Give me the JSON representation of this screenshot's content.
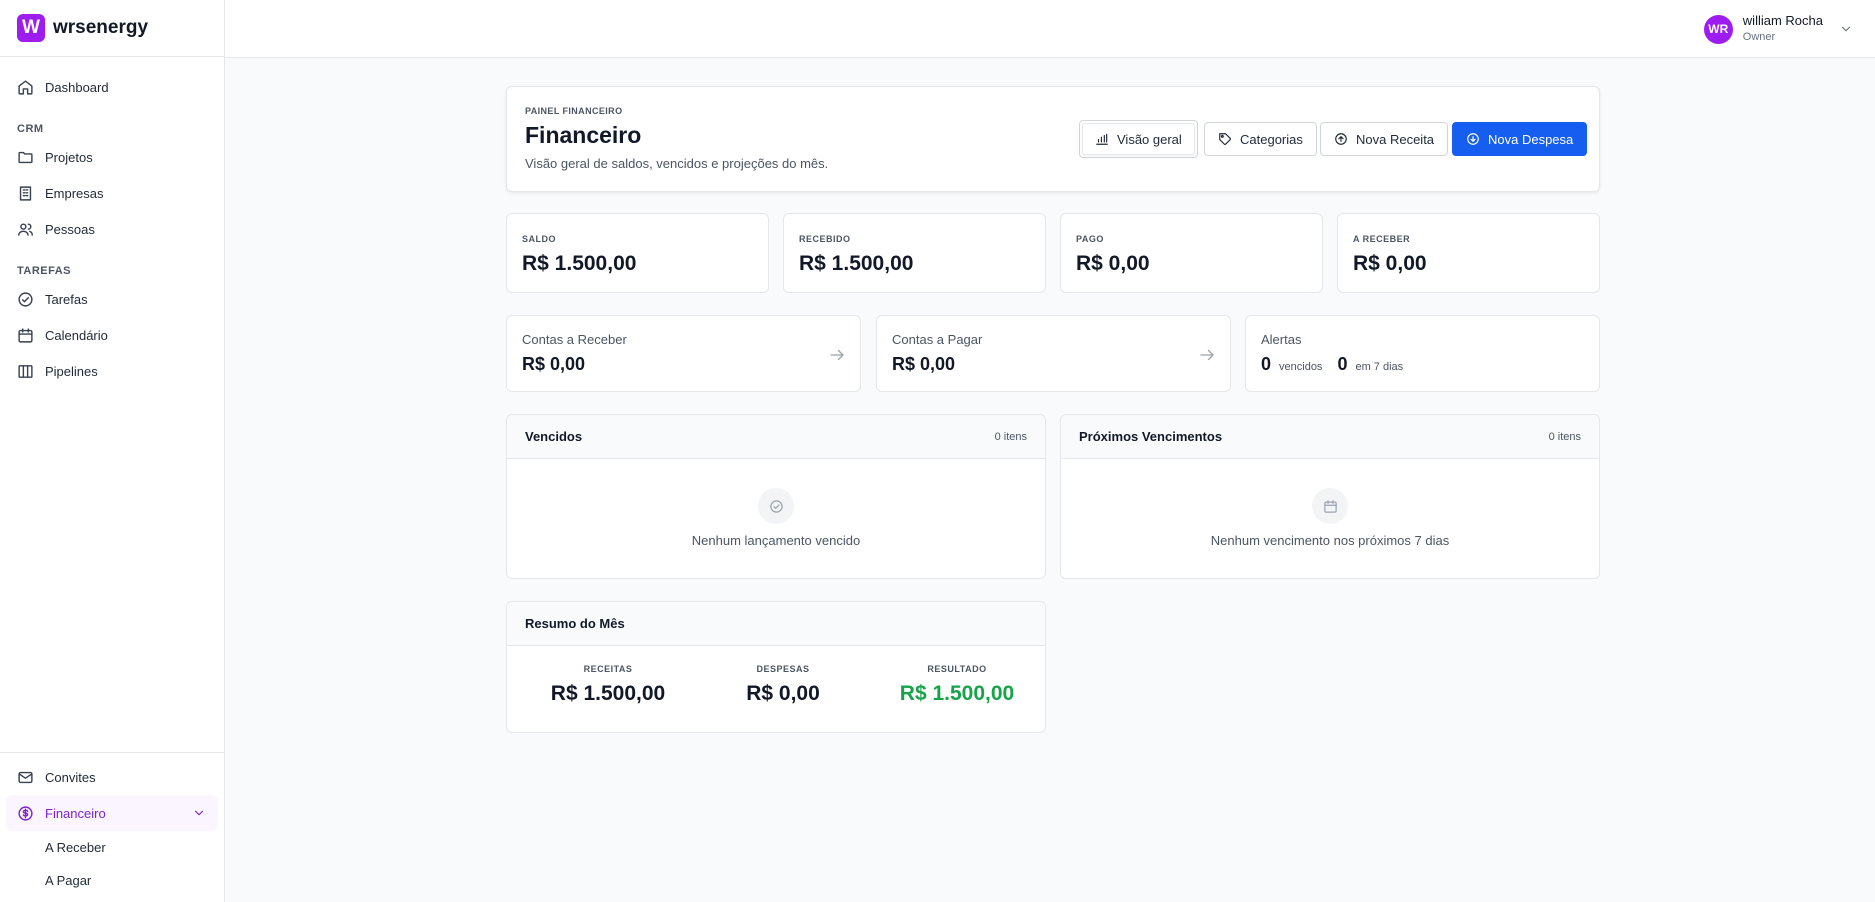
{
  "brand": {
    "logo_letter": "W",
    "name": "wrsenergy",
    "color": "#9d1cf0"
  },
  "sidebar": {
    "top_items": [
      {
        "label": "Dashboard",
        "icon": "home-icon"
      }
    ],
    "sections": [
      {
        "heading": "CRM",
        "items": [
          {
            "label": "Projetos",
            "icon": "folder-icon"
          },
          {
            "label": "Empresas",
            "icon": "building-icon"
          },
          {
            "label": "Pessoas",
            "icon": "users-icon"
          }
        ]
      },
      {
        "heading": "TAREFAS",
        "items": [
          {
            "label": "Tarefas",
            "icon": "check-circle-icon"
          },
          {
            "label": "Calendário",
            "icon": "calendar-icon"
          },
          {
            "label": "Pipelines",
            "icon": "columns-icon"
          }
        ]
      }
    ],
    "bottom_items": [
      {
        "label": "Convites",
        "icon": "mail-icon"
      },
      {
        "label": "Financeiro",
        "icon": "dollar-circle-icon",
        "active": true,
        "children": [
          {
            "label": "A Receber"
          },
          {
            "label": "A Pagar"
          }
        ]
      }
    ]
  },
  "user": {
    "initials": "WR",
    "name": "william Rocha",
    "role": "Owner"
  },
  "header": {
    "kicker": "PAINEL FINANCEIRO",
    "title": "Financeiro",
    "subtitle": "Visão geral de saldos, vencidos e projeções do mês.",
    "buttons": {
      "overview": "Visão geral",
      "categories": "Categorias",
      "new_income": "Nova Receita",
      "new_expense": "Nova Despesa"
    }
  },
  "stats": [
    {
      "label": "SALDO",
      "value": "R$ 1.500,00"
    },
    {
      "label": "RECEBIDO",
      "value": "R$ 1.500,00"
    },
    {
      "label": "PAGO",
      "value": "R$ 0,00"
    },
    {
      "label": "A RECEBER",
      "value": "R$ 0,00"
    }
  ],
  "links": [
    {
      "title": "Contas a Receber",
      "value": "R$ 0,00"
    },
    {
      "title": "Contas a Pagar",
      "value": "R$ 0,00"
    }
  ],
  "alerts": {
    "title": "Alertas",
    "overdue_count": "0",
    "overdue_label": "vencidos",
    "soon_count": "0",
    "soon_label": "em 7 dias"
  },
  "overdue_panel": {
    "title": "Vencidos",
    "count": "0 itens",
    "empty": "Nenhum lançamento vencido"
  },
  "upcoming_panel": {
    "title": "Próximos Vencimentos",
    "count": "0 itens",
    "empty": "Nenhum vencimento nos próximos 7 dias"
  },
  "summary": {
    "title": "Resumo do Mês",
    "income_label": "RECEITAS",
    "income": "R$ 1.500,00",
    "expense_label": "DESPESAS",
    "expense": "R$ 0,00",
    "result_label": "RESULTADO",
    "result": "R$ 1.500,00"
  },
  "colors": {
    "primary": "#155eef",
    "accent": "#9d1cf0",
    "positive": "#16a34a"
  }
}
